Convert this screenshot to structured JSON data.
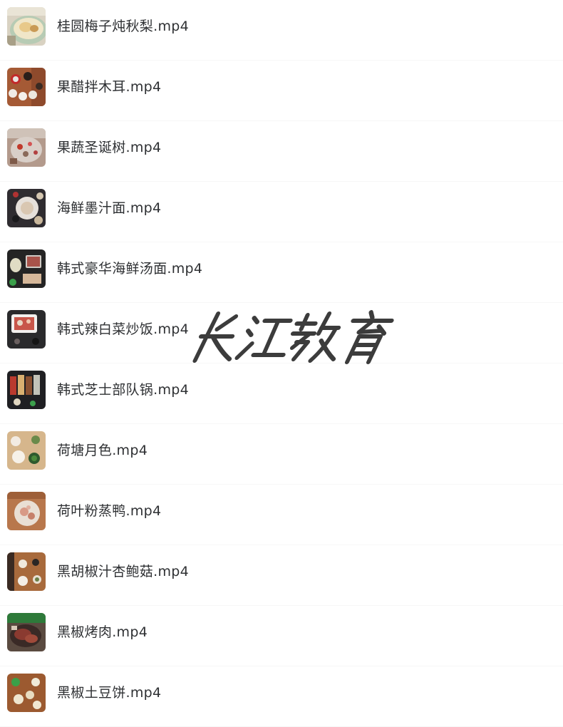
{
  "files": [
    {
      "name": "桂圆梅子炖秋梨.mp4",
      "thumbnail": "food-thumbnail"
    },
    {
      "name": "果醋拌木耳.mp4",
      "thumbnail": "food-thumbnail"
    },
    {
      "name": "果蔬圣诞树.mp4",
      "thumbnail": "food-thumbnail"
    },
    {
      "name": "海鲜墨汁面.mp4",
      "thumbnail": "food-thumbnail"
    },
    {
      "name": "韩式豪华海鲜汤面.mp4",
      "thumbnail": "food-thumbnail"
    },
    {
      "name": "韩式辣白菜炒饭.mp4",
      "thumbnail": "food-thumbnail"
    },
    {
      "name": "韩式芝士部队锅.mp4",
      "thumbnail": "food-thumbnail"
    },
    {
      "name": "荷塘月色.mp4",
      "thumbnail": "food-thumbnail"
    },
    {
      "name": "荷叶粉蒸鸭.mp4",
      "thumbnail": "food-thumbnail"
    },
    {
      "name": "黑胡椒汁杏鲍菇.mp4",
      "thumbnail": "food-thumbnail"
    },
    {
      "name": "黑椒烤肉.mp4",
      "thumbnail": "food-thumbnail"
    },
    {
      "name": "黑椒土豆饼.mp4",
      "thumbnail": "food-thumbnail"
    }
  ],
  "watermark": {
    "text": "长江教育",
    "color": "#3c3c3c"
  }
}
